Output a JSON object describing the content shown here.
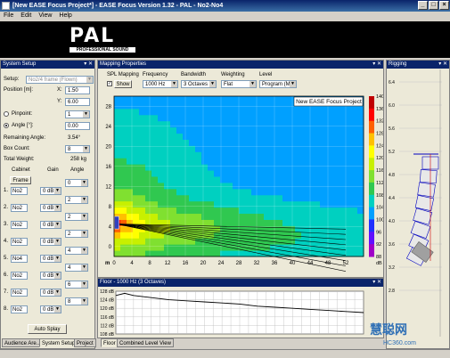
{
  "window": {
    "title": "[New EASE Focus Project*] - EASE Focus Version 1.32 - PAL - No2-No4",
    "controls": [
      "_",
      "□",
      "×"
    ]
  },
  "menu": [
    "File",
    "Edit",
    "View",
    "Help"
  ],
  "brand": {
    "logo_text": "PAL",
    "tagline": "PROFESSIONAL SOUND SYSTEMS"
  },
  "system_setup": {
    "header": "System Setup",
    "setup_label": "Setup:",
    "setup_value": "No2/4 frame (Flown)",
    "position_label": "Position [m]:",
    "x_label": "X:",
    "x_value": "1.50",
    "y_label": "Y:",
    "y_value": "6.00",
    "pinpoint_label": "Pinpoint:",
    "pinpoint_value": "1",
    "angle_label": "Angle [°]:",
    "angle_value": "0.00",
    "remaining_label": "Remaining Angle:",
    "remaining_value": "3.54°",
    "boxcount_label": "Box Count:",
    "boxcount_value": "8",
    "weight_label": "Total Weight:",
    "weight_value": "258 kg",
    "col_cabinet": "Cabinet",
    "col_gain": "Gain",
    "col_angle": "Angle",
    "frame_label": "Frame",
    "rows": [
      {
        "idx": "1.",
        "cabinet": "No2",
        "gain": "0 dB",
        "angle": "0"
      },
      {
        "idx": "2.",
        "cabinet": "No2",
        "gain": "0 dB",
        "angle": "2"
      },
      {
        "idx": "3.",
        "cabinet": "No2",
        "gain": "0 dB",
        "angle": "2"
      },
      {
        "idx": "4.",
        "cabinet": "No2",
        "gain": "0 dB",
        "angle": "2"
      },
      {
        "idx": "5.",
        "cabinet": "No4",
        "gain": "0 dB",
        "angle": "4"
      },
      {
        "idx": "6.",
        "cabinet": "No2",
        "gain": "0 dB",
        "angle": "4"
      },
      {
        "idx": "7.",
        "cabinet": "No2",
        "gain": "0 dB",
        "angle": "6"
      },
      {
        "idx": "8.",
        "cabinet": "No2",
        "gain": "0 dB",
        "angle": "8"
      }
    ],
    "auto_splay_label": "Auto Splay",
    "tabs": [
      "Audience Are...",
      "System Setup",
      "Project"
    ]
  },
  "mapping": {
    "header": "Mapping Properties",
    "spl_label": "SPL Mapping",
    "show_label": "Show",
    "frequency_label": "Frequency",
    "frequency_value": "1000 Hz",
    "bandwidth_label": "Bandwidth",
    "bandwidth_value": "3 Octaves",
    "weighting_label": "Weighting",
    "weighting_value": "Flat",
    "level_label": "Level",
    "level_value": "Program (Ma",
    "plot_title": "New EASE Focus Project",
    "x_ticks": [
      "0",
      "4",
      "8",
      "12",
      "16",
      "20",
      "24",
      "28",
      "32",
      "36",
      "40",
      "44",
      "48",
      "52"
    ],
    "y_ticks": [
      "28",
      "24",
      "20",
      "16",
      "12",
      "8",
      "4",
      "0"
    ],
    "unit_x": "m",
    "scale_ticks": [
      "140",
      "136",
      "132",
      "128",
      "124",
      "120",
      "116",
      "112",
      "108",
      "104",
      "100",
      "96",
      "92",
      "88"
    ],
    "scale_unit": "dB"
  },
  "floor": {
    "header": "Floor - 1000 Hz (3 Octaves)",
    "y_ticks": [
      "128 dB",
      "124 dB",
      "120 dB",
      "116 dB",
      "112 dB",
      "108 dB"
    ],
    "tabs": [
      "Floor",
      "Combined Level View"
    ]
  },
  "rigging": {
    "header": "Rigging",
    "y_ticks": [
      "6.4",
      "6.0",
      "5.6",
      "5.2",
      "4.8",
      "4.4",
      "4.0",
      "3.6",
      "3.2",
      "2.8"
    ]
  },
  "watermark": {
    "main": "慧聪网",
    "sub": "HC360.com"
  },
  "chart_data": {
    "type": "heatmap",
    "title": "New EASE Focus Project",
    "xlabel": "m",
    "ylabel": "",
    "xlim": [
      0,
      56
    ],
    "ylim": [
      -2,
      30
    ],
    "colorbar": {
      "min": 88,
      "max": 140,
      "unit": "dB"
    },
    "source": {
      "x": 0.5,
      "y": 4.5
    },
    "floor_curve": {
      "x": [
        0,
        2,
        4,
        8,
        12,
        16,
        20,
        24,
        28,
        32,
        36,
        40,
        44,
        48,
        52,
        56
      ],
      "y": [
        126,
        127,
        126,
        125,
        124,
        123.5,
        123,
        122.5,
        122,
        121,
        120.5,
        120,
        119.5,
        119,
        118.5,
        118
      ]
    }
  }
}
